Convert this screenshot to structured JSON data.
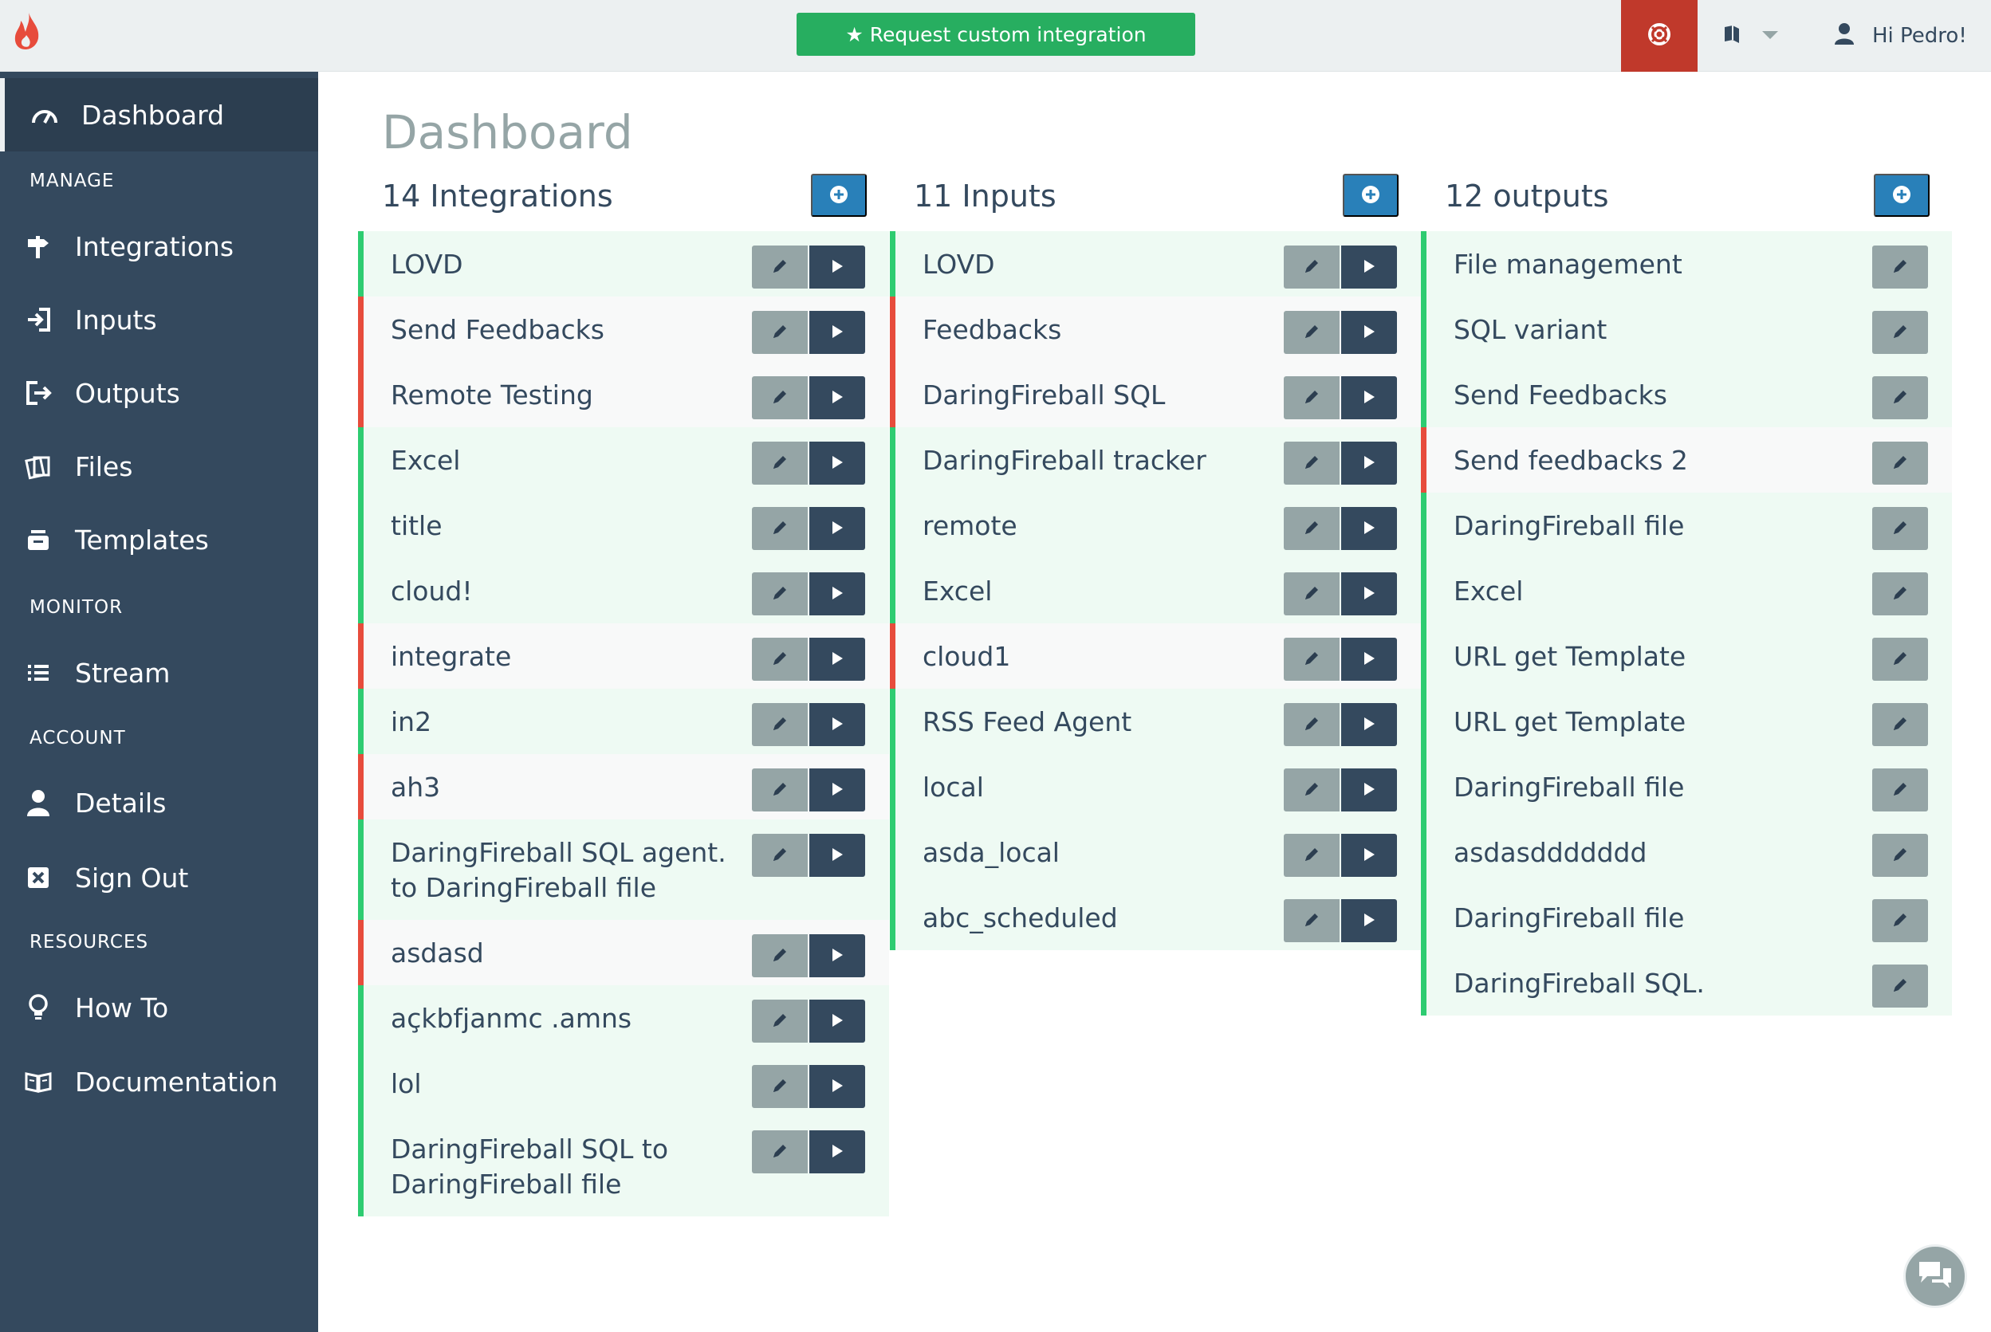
{
  "topbar": {
    "request_label": "★ Request custom integration",
    "greeting": "Hi Pedro!"
  },
  "sidebar": {
    "dashboard": "Dashboard",
    "sections": {
      "manage": "MANAGE",
      "monitor": "MONITOR",
      "account": "ACCOUNT",
      "resources": "RESOURCES"
    },
    "items": {
      "integrations": "Integrations",
      "inputs": "Inputs",
      "outputs": "Outputs",
      "files": "Files",
      "templates": "Templates",
      "stream": "Stream",
      "details": "Details",
      "signout": "Sign Out",
      "howto": "How To",
      "documentation": "Documentation"
    }
  },
  "main": {
    "title": "Dashboard",
    "integrations": {
      "title": "14 Integrations",
      "items": [
        {
          "label": "LOVD",
          "active": true
        },
        {
          "label": "Send Feedbacks",
          "active": false
        },
        {
          "label": "Remote Testing",
          "active": false
        },
        {
          "label": "Excel",
          "active": true
        },
        {
          "label": "title",
          "active": true
        },
        {
          "label": "cloud!",
          "active": true
        },
        {
          "label": "integrate",
          "active": false
        },
        {
          "label": "in2",
          "active": true
        },
        {
          "label": "ah3",
          "active": false
        },
        {
          "label": "DaringFireball SQL agent. to DaringFireball file",
          "active": true
        },
        {
          "label": "asdasd",
          "active": false
        },
        {
          "label": "açkbfjanmc .amns",
          "active": true
        },
        {
          "label": "lol",
          "active": true
        },
        {
          "label": "DaringFireball SQL to DaringFireball file",
          "active": true
        }
      ]
    },
    "inputs": {
      "title": "11 Inputs",
      "items": [
        {
          "label": "LOVD",
          "active": true
        },
        {
          "label": "Feedbacks",
          "active": false
        },
        {
          "label": "DaringFireball SQL",
          "active": false
        },
        {
          "label": "DaringFireball tracker",
          "active": true
        },
        {
          "label": "remote",
          "active": true
        },
        {
          "label": "Excel",
          "active": true
        },
        {
          "label": "cloud1",
          "active": false
        },
        {
          "label": "RSS Feed Agent",
          "active": true
        },
        {
          "label": "local",
          "active": true
        },
        {
          "label": "asda_local",
          "active": true
        },
        {
          "label": "abc_scheduled",
          "active": true
        }
      ]
    },
    "outputs": {
      "title": "12 outputs",
      "items": [
        {
          "label": "File management",
          "active": true
        },
        {
          "label": "SQL variant",
          "active": true
        },
        {
          "label": "Send Feedbacks",
          "active": true
        },
        {
          "label": "Send feedbacks 2",
          "active": false
        },
        {
          "label": "DaringFireball file",
          "active": true
        },
        {
          "label": "Excel",
          "active": true
        },
        {
          "label": "URL get Template",
          "active": true
        },
        {
          "label": "URL get Template",
          "active": true
        },
        {
          "label": "DaringFireball file",
          "active": true
        },
        {
          "label": "asdasddddddd",
          "active": true
        },
        {
          "label": "DaringFireball file",
          "active": true
        },
        {
          "label": "DaringFireball SQL.",
          "active": true
        }
      ]
    }
  },
  "colors": {
    "sidebar": "#34495e",
    "active_border": "#2ecc71",
    "inactive_border": "#e74c3c",
    "add_button": "#2980b9",
    "request_button": "#27ae60",
    "support": "#c0392b"
  }
}
